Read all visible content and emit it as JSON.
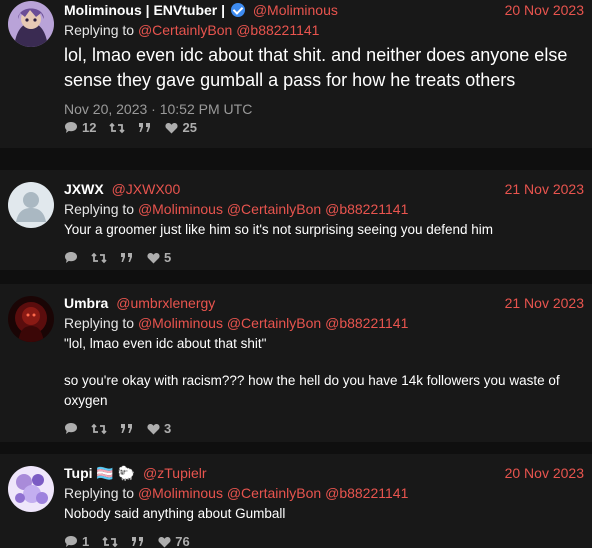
{
  "main_post": {
    "name": "Moliminous | ENVtuber |",
    "handle": "@Moliminous",
    "date": "20 Nov 2023",
    "replying_label": "Replying to",
    "replying_to": [
      "@CertainlyBon",
      "@b88221141"
    ],
    "text": "lol, lmao even idc about that shit. and neither does anyone else sense they gave gumball a pass for how he treats others",
    "timestamp": "Nov 20, 2023 · 10:52 PM UTC",
    "stats": {
      "replies": "12",
      "retweets": "",
      "quotes": "",
      "likes": "25"
    }
  },
  "replies": [
    {
      "name": "JXWX",
      "handle": "@JXWX00",
      "date": "21 Nov 2023",
      "replying_label": "Replying to",
      "replying_to": [
        "@Moliminous",
        "@CertainlyBon",
        "@b88221141"
      ],
      "text": "Your a groomer just like him so it's not surprising seeing you defend him",
      "stats": {
        "replies": "",
        "retweets": "",
        "quotes": "",
        "likes": "5"
      }
    },
    {
      "name": "Umbra",
      "handle": "@umbrxlenergy",
      "date": "21 Nov 2023",
      "replying_label": "Replying to",
      "replying_to": [
        "@Moliminous",
        "@CertainlyBon",
        "@b88221141"
      ],
      "text_quote": "\"lol, lmao even idc about that shit\"",
      "text": "so you're okay with racism??? how the hell do you have 14k followers you waste of oxygen",
      "stats": {
        "replies": "",
        "retweets": "",
        "quotes": "",
        "likes": "3"
      }
    },
    {
      "name": "Tupi 🏳️‍⚧️ 🐑",
      "handle": "@zTupielr",
      "date": "20 Nov 2023",
      "replying_label": "Replying to",
      "replying_to": [
        "@Moliminous",
        "@CertainlyBon",
        "@b88221141"
      ],
      "text": "Nobody said anything about Gumball",
      "stats": {
        "replies": "1",
        "retweets": "",
        "quotes": "",
        "likes": "76"
      }
    }
  ],
  "icons": {
    "reply": "comment-icon",
    "retweet": "retweet-icon",
    "quote": "quote-icon",
    "like": "heart-icon",
    "verified": "verified-badge-icon"
  },
  "colors": {
    "accent": "#e8544e",
    "background": "#0f0f0f",
    "card": "#181818",
    "muted": "#9a9a9a"
  }
}
